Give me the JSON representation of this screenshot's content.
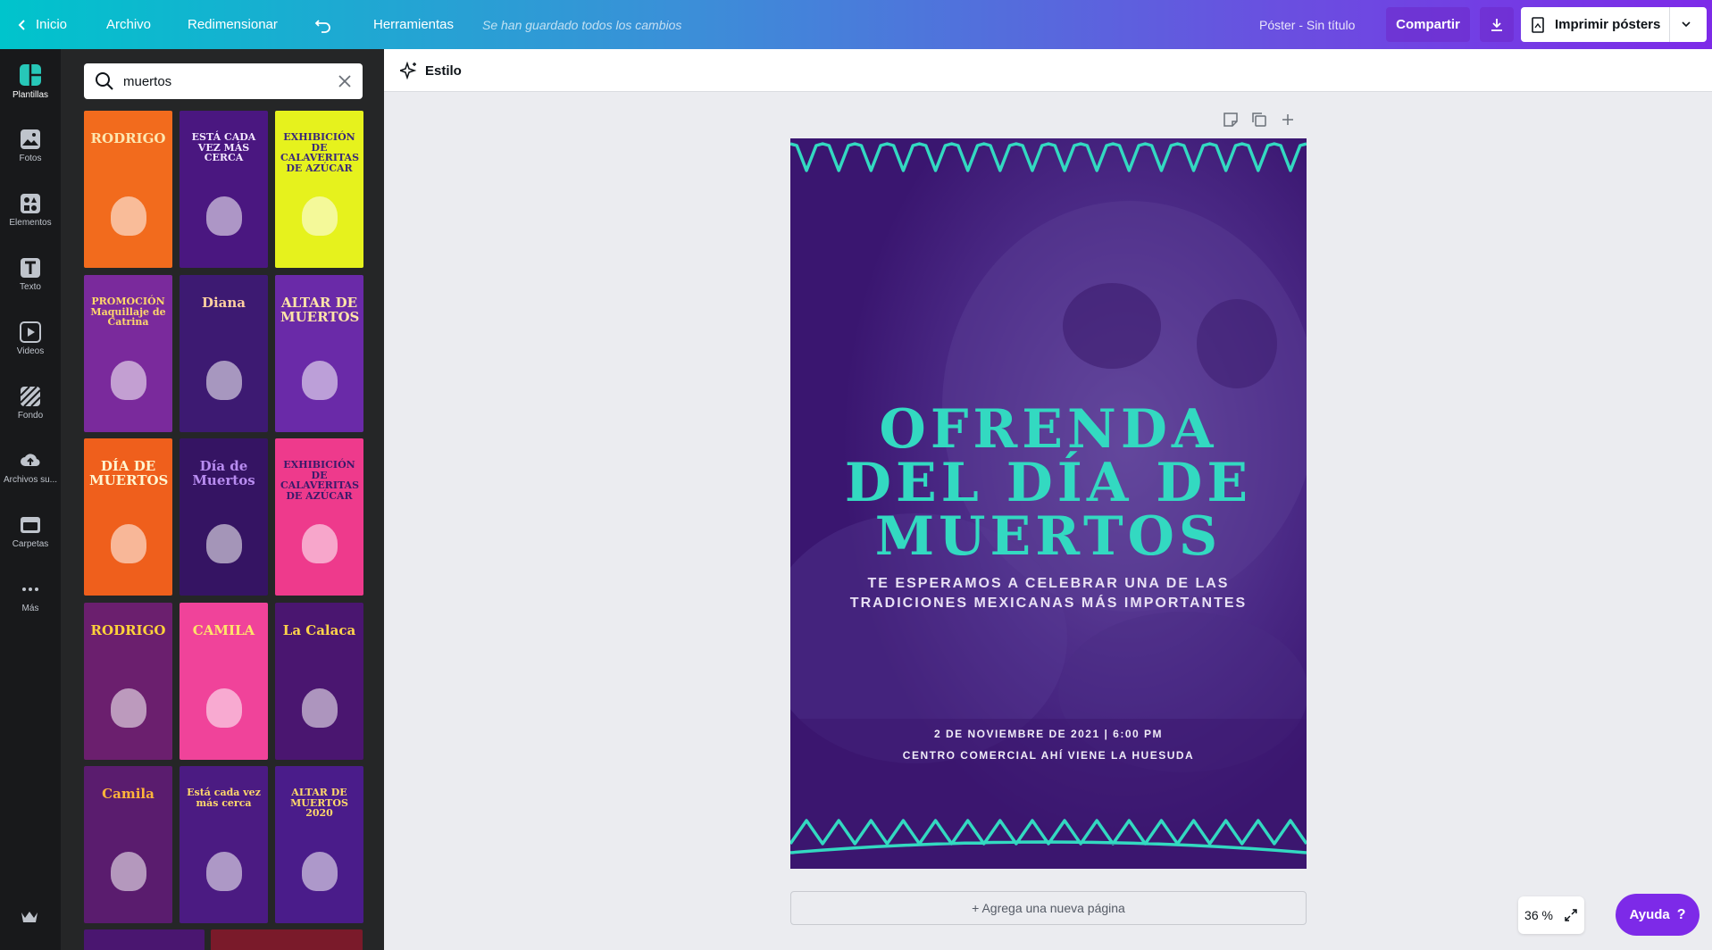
{
  "topbar": {
    "home": "Inicio",
    "file": "Archivo",
    "resize": "Redimensionar",
    "tools": "Herramientas",
    "saved_status": "Se han guardado todos los cambios",
    "doc_title": "Póster - Sin título",
    "share": "Compartir",
    "print": "Imprimir pósters"
  },
  "sidebar": {
    "items": [
      {
        "label": "Plantillas",
        "icon": "templates-icon"
      },
      {
        "label": "Fotos",
        "icon": "photos-icon"
      },
      {
        "label": "Elementos",
        "icon": "elements-icon"
      },
      {
        "label": "Texto",
        "icon": "text-icon"
      },
      {
        "label": "Videos",
        "icon": "videos-icon"
      },
      {
        "label": "Fondo",
        "icon": "background-icon"
      },
      {
        "label": "Archivos su...",
        "icon": "uploads-icon"
      },
      {
        "label": "Carpetas",
        "icon": "folders-icon"
      },
      {
        "label": "Más",
        "icon": "more-icon"
      }
    ]
  },
  "panel": {
    "search_value": "muertos",
    "templates": [
      {
        "text": "RODRIGO",
        "bg": "#f26b1d",
        "fg": "#fde7b0"
      },
      {
        "text": "ESTÁ CADA VEZ MÁS CERCA",
        "bg": "#4a1780",
        "fg": "#f3e7ff"
      },
      {
        "text": "EXHIBICIÓN DE CALAVERITAS DE AZÚCAR",
        "bg": "#e6f21d",
        "fg": "#3a2a7a"
      },
      {
        "text": "PROMOCIÓN Maquillaje de Catrina",
        "bg": "#7a2a9c",
        "fg": "#ffd86b"
      },
      {
        "text": "Diana",
        "bg": "#3d1a72",
        "fg": "#ffd0a0"
      },
      {
        "text": "ALTAR DE MUERTOS",
        "bg": "#6a2aa8",
        "fg": "#ffe4a8"
      },
      {
        "text": "DÍA DE MUERTOS",
        "bg": "#ef5f1c",
        "fg": "#fff5d0"
      },
      {
        "text": "Día de Muertos",
        "bg": "#351463",
        "fg": "#b88cf0"
      },
      {
        "text": "EXHIBICIÓN DE CALAVERITAS DE AZÚCAR",
        "bg": "#ee3a8c",
        "fg": "#3a1a6a"
      },
      {
        "text": "RODRIGO",
        "bg": "#6b1f6e",
        "fg": "#ffd23a"
      },
      {
        "text": "CAMILA",
        "bg": "#f0439a",
        "fg": "#ffe46a"
      },
      {
        "text": "La Calaca",
        "bg": "#4a1670",
        "fg": "#ffd44a"
      },
      {
        "text": "Camila",
        "bg": "#5a1c6e",
        "fg": "#ffb43a"
      },
      {
        "text": "Está cada vez más cerca",
        "bg": "#4b1b82",
        "fg": "#ffd86b"
      },
      {
        "text": "ALTAR DE MUERTOS 2020",
        "bg": "#4a1c8a",
        "fg": "#ffd86b"
      }
    ]
  },
  "toolbar": {
    "style": "Estilo"
  },
  "poster": {
    "title_lines": [
      "OFRENDA",
      "DEL DÍA DE",
      "MUERTOS"
    ],
    "subtitle_lines": [
      "TE ESPERAMOS A CELEBRAR UNA DE LAS",
      "TRADICIONES MEXICANAS MÁS IMPORTANTES"
    ],
    "date": "2 DE NOVIEMBRE DE 2021 | 6:00 PM",
    "venue": "CENTRO COMERCIAL AHÍ VIENE LA HUESUDA",
    "accent": "#33d9c1",
    "background": "#3e1a6e"
  },
  "add_page": "+ Agrega una nueva página",
  "zoom": "36 %",
  "help": "Ayuda"
}
